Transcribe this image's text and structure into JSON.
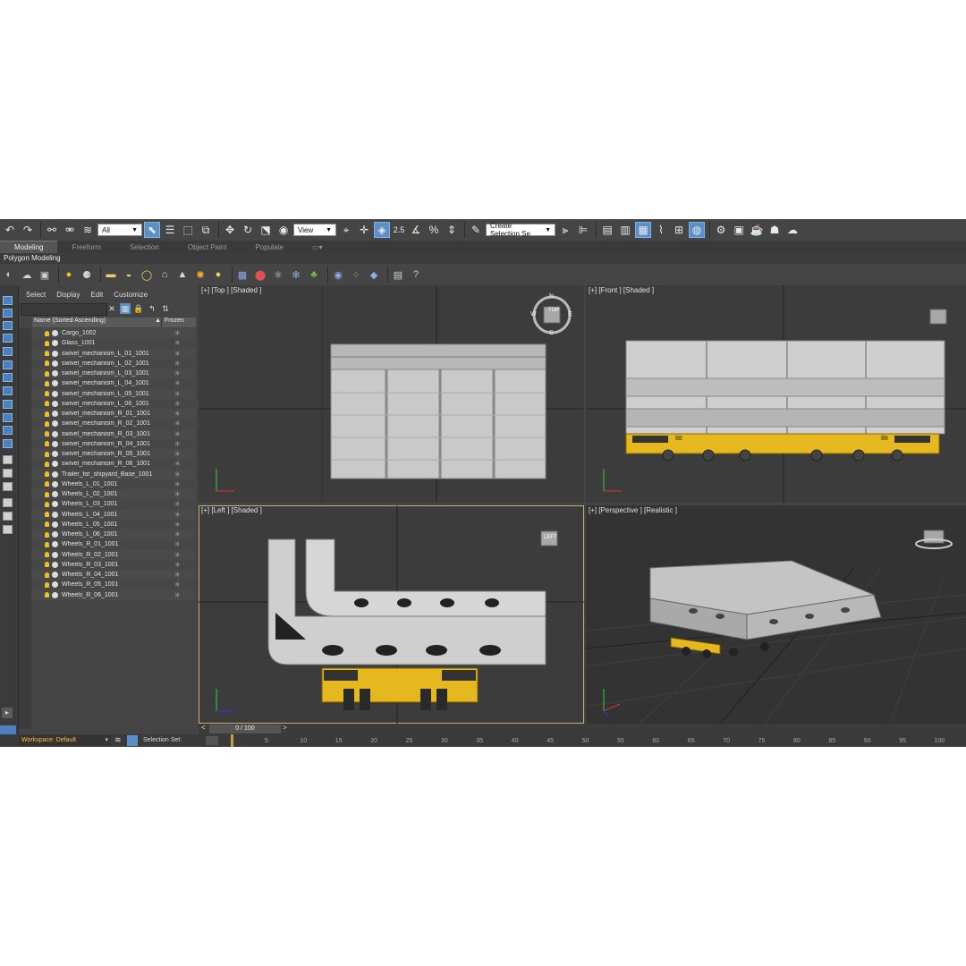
{
  "toolbar": {
    "filter_dropdown": "All",
    "refcoord_dropdown": "View",
    "snap_label": "2.5",
    "selection_set_dropdown": "Create Selection Se"
  },
  "ribbon": {
    "tabs": [
      "Modeling",
      "Freeform",
      "Selection",
      "Object Paint",
      "Populate"
    ],
    "subtitle": "Polygon Modeling"
  },
  "explorer": {
    "menu": [
      "Select",
      "Display",
      "Edit",
      "Customize"
    ],
    "col_name": "Name (Sorted Ascending)",
    "sort_arrow": "▲",
    "col_frozen": "Frozen",
    "items": [
      "Cargo_1002",
      "Glass_1001",
      "swivel_mechanism_L_01_1001",
      "swivel_mechanism_L_02_1001",
      "swivel_mechanism_L_03_1001",
      "swivel_mechanism_L_04_1001",
      "swivel_mechanism_L_05_1001",
      "swivel_mechanism_L_06_1001",
      "swivel_mechanism_R_01_1001",
      "swivel_mechanism_R_02_1001",
      "swivel_mechanism_R_03_1001",
      "swivel_mechanism_R_04_1001",
      "swivel_mechanism_R_05_1001",
      "swivel_mechanism_R_06_1001",
      "Trailer_for_shipyard_Base_1001",
      "Wheels_L_01_1001",
      "Wheels_L_02_1001",
      "Wheels_L_03_1001",
      "Wheels_L_04_1001",
      "Wheels_L_05_1001",
      "Wheels_L_06_1001",
      "Wheels_R_01_1001",
      "Wheels_R_02_1001",
      "Wheels_R_03_1001",
      "Wheels_R_04_1001",
      "Wheels_R_05_1001",
      "Wheels_R_06_1001"
    ]
  },
  "viewports": {
    "top": "[+] [Top ] [Shaded ]",
    "front": "[+] [Front ] [Shaded ]",
    "left": "[+] [Left ] [Shaded ]",
    "perspective": "[+] [Perspective ] [Realistic ]",
    "viewcube_top": "TOP",
    "viewcube_left": "LEFT",
    "compass": {
      "n": "N",
      "s": "S",
      "e": "E",
      "w": "W"
    },
    "trailer_number": "88"
  },
  "timeline": {
    "frame_display": "0 / 100",
    "prev_arrow": "<",
    "next_arrow": ">",
    "ticks": [
      "5",
      "10",
      "15",
      "20",
      "25",
      "30",
      "35",
      "40",
      "45",
      "50",
      "55",
      "60",
      "65",
      "70",
      "75",
      "80",
      "85",
      "90",
      "95",
      "100"
    ]
  },
  "status": {
    "workspace": "Workspace: Default",
    "selection_set": "Selection Set:"
  },
  "colors": {
    "app_bg": "#444444",
    "active_blue": "#5b8fc8",
    "trailer_yellow": "#e6b820",
    "cargo_grey": "#c8c8c8",
    "light_bulb": "#f0c020"
  }
}
